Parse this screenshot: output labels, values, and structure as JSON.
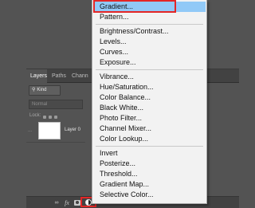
{
  "layers_panel": {
    "tabs": [
      {
        "label": "Layers",
        "active": true
      },
      {
        "label": "Paths",
        "active": false
      },
      {
        "label": "Chann",
        "active": false
      }
    ],
    "kind_filter": "Kind",
    "blend_mode": "Normal",
    "lock_label": "Lock:",
    "layer": {
      "name": "Layer 0",
      "visibility_placeholder": "..."
    },
    "footer_icons": [
      "link-icon",
      "fx-icon",
      "mask-icon",
      "adjustment-layer-icon",
      "folder-icon",
      "new-layer-icon",
      "trash-icon"
    ],
    "fx_label": "fx"
  },
  "adjustment_menu": {
    "groups": [
      [
        "Gradient...",
        "Pattern..."
      ],
      [
        "Brightness/Contrast...",
        "Levels...",
        "Curves...",
        "Exposure..."
      ],
      [
        "Vibrance...",
        "Hue/Saturation...",
        "Color Balance...",
        "Black  White...",
        "Photo Filter...",
        "Channel Mixer...",
        "Color Lookup..."
      ],
      [
        "Invert",
        "Posterize...",
        "Threshold...",
        "Gradient Map...",
        "Selective Color..."
      ]
    ],
    "highlighted_item": "Gradient...",
    "colors": {
      "highlight": "#91c9f7",
      "callout": "#e32626"
    }
  }
}
